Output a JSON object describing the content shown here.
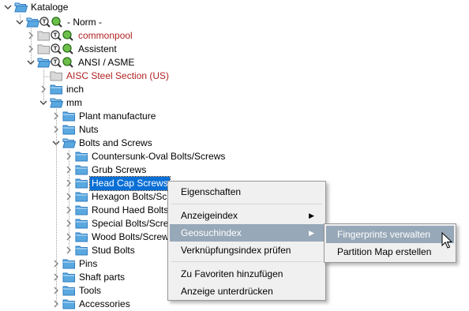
{
  "tree": {
    "root": "Kataloge",
    "norm": "- Norm -",
    "commonpool": "commonpool",
    "assistent": "Assistent",
    "ansi": "ANSI / ASME",
    "aisc": "AISC Steel Section (US)",
    "inch": "inch",
    "mm": "mm",
    "plant": "Plant manufacture",
    "nuts": "Nuts",
    "bolts": "Bolts and Screws",
    "countersunk": "Countersunk-Oval Bolts/Screws",
    "grub": "Grub Screws",
    "headcap": "Head Cap Screws",
    "hexagon": "Hexagon Bolts/Scr",
    "round": "Round Haed Bolts/",
    "special": "Special Bolts/Screw",
    "wood": "Wood Bolts/Screw",
    "stud": "Stud Bolts",
    "pins": "Pins",
    "shaft": "Shaft parts",
    "tools": "Tools",
    "accessories": "Accessories"
  },
  "context_menu": {
    "properties": "Eigenschaften",
    "display_index": "Anzeigeindex",
    "geo_index": "Geosuchindex",
    "link_index": "Verknüpfungsindex prüfen",
    "add_favorites": "Zu Favoriten hinzufügen",
    "suppress": "Anzeige unterdrücken"
  },
  "submenu": {
    "fingerprints": "Fingerprints verwalten",
    "partition_map": "Partition Map erstellen"
  },
  "colors": {
    "selection": "#0a6fd6",
    "menu_highlight": "#97a8b8",
    "folder": "#5aa8e0",
    "red_label": "#b22222"
  }
}
